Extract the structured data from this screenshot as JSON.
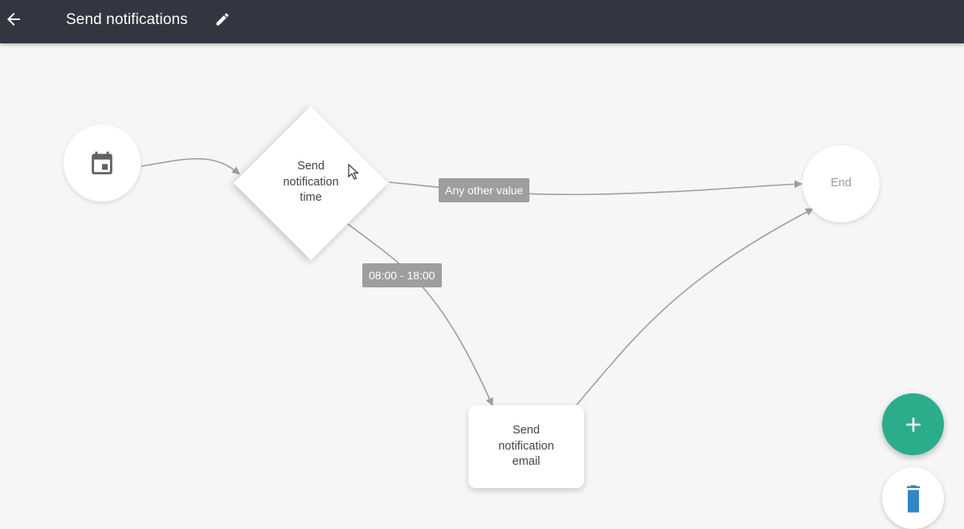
{
  "header": {
    "title": "Send notifications",
    "back_icon": "arrow-left-icon",
    "edit_icon": "pencil-icon"
  },
  "flow": {
    "start_node": {
      "icon": "calendar-icon"
    },
    "decision_node": {
      "label": "Send notification time"
    },
    "task_node": {
      "label": "Send notification email"
    },
    "end_node": {
      "label": "End"
    },
    "edge_labels": {
      "other": "Any other value",
      "time_range": "08:00 - 18:00"
    }
  },
  "actions": {
    "add_icon": "plus-icon",
    "delete_icon": "trash-icon"
  },
  "colors": {
    "topbar": "#333540",
    "canvas": "#f6f6f6",
    "edge": "#9e9e9e",
    "fab_add": "#2bad8c",
    "delete_icon": "#2f87c9"
  }
}
